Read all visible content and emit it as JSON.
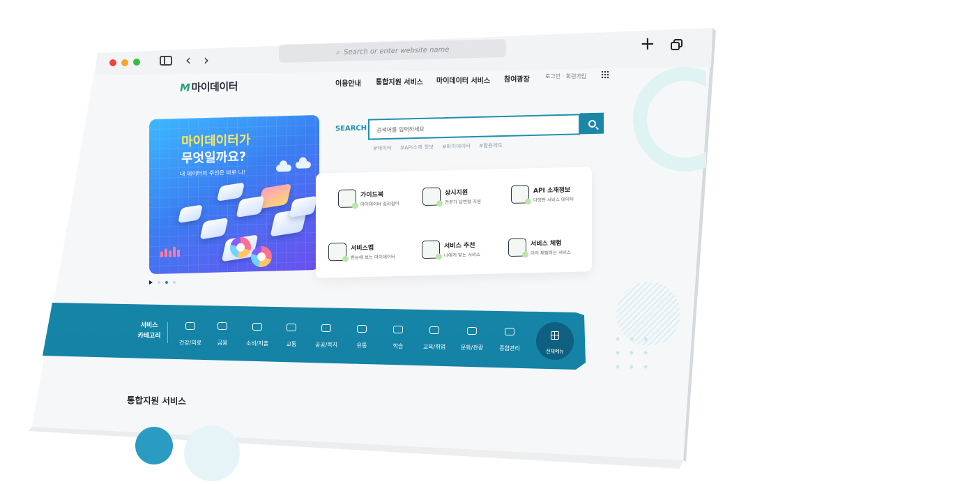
{
  "browser": {
    "address_placeholder": "Search or enter website name",
    "new_tab_glyph": "+",
    "back_glyph": "‹",
    "forward_glyph": "›"
  },
  "site": {
    "logo_mark": "M",
    "logo_text": "마이데이터",
    "nav": [
      "이용안내",
      "통합지원 서비스",
      "마이데이터 서비스",
      "참여광장"
    ],
    "util_links": "로그인 · 회원가입"
  },
  "banner": {
    "title_line1": "마이데이터가",
    "title_line2": "무엇일까요?",
    "subtitle": "내 데이터의 주인은 바로 나!"
  },
  "search": {
    "label": "SEARCH",
    "placeholder": "검색어를 입력하세요",
    "tags": [
      "#데이터",
      "#API소재 정보",
      "#마이데이터",
      "#활용제도"
    ]
  },
  "quick_menu": [
    {
      "title": "가이드북",
      "desc": "마이데이터 길라잡이",
      "icon": "guidebook-icon"
    },
    {
      "title": "상시지원",
      "desc": "전문가 답변형 지원",
      "icon": "support-icon"
    },
    {
      "title": "API 소재정보",
      "desc": "다양한 서비스 데이터",
      "icon": "api-icon"
    },
    {
      "title": "서비스맵",
      "desc": "한눈에 보는 마이데이터",
      "icon": "service-map-icon"
    },
    {
      "title": "서비스 추천",
      "desc": "나에게 맞는 서비스",
      "icon": "thumbs-up-icon"
    },
    {
      "title": "서비스 체험",
      "desc": "미리 체험하는 서비스",
      "icon": "experience-icon"
    }
  ],
  "categories": {
    "title": "서비스 카테고리",
    "items": [
      "건강/의료",
      "금융",
      "소비/지출",
      "교통",
      "공공/복지",
      "유통",
      "학습",
      "교육/취업",
      "문화/관광",
      "종합관리"
    ],
    "all_menu": "전체메뉴"
  },
  "section": {
    "title": "통합지원 서비스"
  },
  "colors": {
    "accent": "#1a8db0",
    "brand_green": "#2aa77a",
    "banner_start": "#3db8ff",
    "banner_end": "#6c4ff0"
  }
}
